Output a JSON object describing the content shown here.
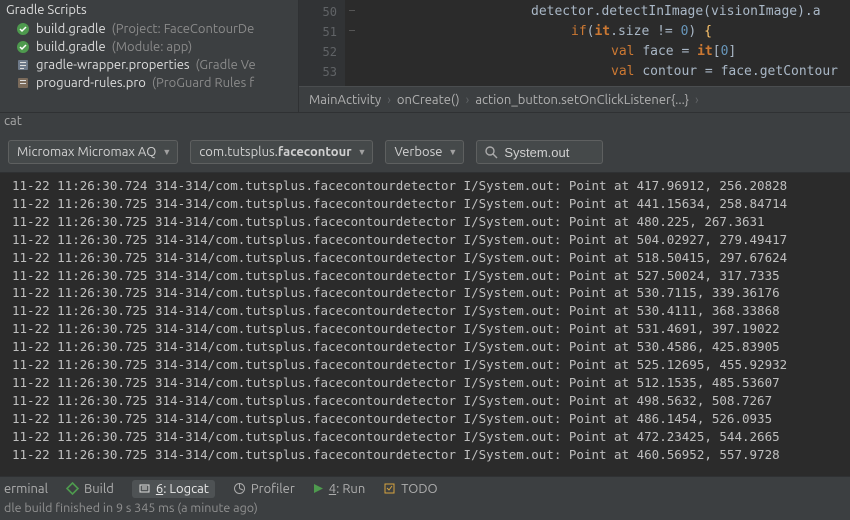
{
  "tree": {
    "header": "Gradle Scripts",
    "items": [
      {
        "name": "build.gradle",
        "sub": " (Project: FaceContourDe",
        "icon": "gradle"
      },
      {
        "name": "build.gradle",
        "sub": " (Module: app)",
        "icon": "gradle"
      },
      {
        "name": "gradle-wrapper.properties",
        "sub": " (Gradle Ve",
        "icon": "props"
      },
      {
        "name": "proguard-rules.pro",
        "sub": " (ProGuard Rules f",
        "icon": "pro"
      }
    ]
  },
  "editor": {
    "gutter": [
      "50",
      "51",
      "52",
      "53"
    ],
    "lines": [
      {
        "indent": 170,
        "tokens": [
          [
            "c-base",
            "detector.detectInImage(visionImage).a"
          ]
        ]
      },
      {
        "indent": 210,
        "tokens": [
          [
            "c-key",
            "if"
          ],
          [
            "c-base",
            "("
          ],
          [
            "c-key c-bold",
            "it"
          ],
          [
            "c-base",
            ".size != "
          ],
          [
            "c-num",
            "0"
          ],
          [
            "c-base",
            ") "
          ],
          [
            "c-kw2",
            "{"
          ]
        ]
      },
      {
        "indent": 250,
        "tokens": [
          [
            "c-key",
            "val "
          ],
          [
            "c-base",
            "face = "
          ],
          [
            "c-key c-bold",
            "it"
          ],
          [
            "c-base",
            "["
          ],
          [
            "c-num",
            "0"
          ],
          [
            "c-base",
            "]"
          ]
        ]
      },
      {
        "indent": 250,
        "tokens": [
          [
            "c-key",
            "val "
          ],
          [
            "c-id",
            "contour = face.getContour"
          ]
        ]
      }
    ],
    "breadcrumbs": [
      "MainActivity",
      "onCreate()",
      "action_button.setOnClickListener{...}"
    ]
  },
  "panel_tab": "cat",
  "toolbar": {
    "device": "Micromax Micromax AQ",
    "package_html": "com.tutsplus.<b>facecontour</b>",
    "package": "com.tutsplus.facecontour",
    "level": "Verbose",
    "search_value": "System.out"
  },
  "log_prefix": "11-22 11:26:30.",
  "log_ms": [
    "724",
    "725",
    "725",
    "725",
    "725",
    "725",
    "725",
    "725",
    "725",
    "725",
    "725",
    "725",
    "725",
    "725",
    "725",
    "725"
  ],
  "log_proc": "314-314/com.tutsplus.facecontourdetector I/System.out: Point at ",
  "log_points": [
    "417.96912, 256.20828",
    "441.15634, 258.84714",
    "480.225, 267.3631",
    "504.02927, 279.49417",
    "518.50415, 297.67624",
    "527.50024, 317.7335",
    "530.7115, 339.36176",
    "530.4111, 368.33868",
    "531.4691, 397.19022",
    "530.4586, 425.83905",
    "525.12695, 455.92932",
    "512.1535, 485.53607",
    "498.5632, 508.7267",
    "486.1454, 526.0935",
    "472.23425, 544.2665",
    "460.56952, 557.9728"
  ],
  "bottom_tabs": {
    "terminal": "erminal",
    "build": "Build",
    "logcat": "6: Logcat",
    "profiler": "Profiler",
    "run": "4: Run",
    "todo": "TODO"
  },
  "status": "dle build finished in 9 s 345 ms (a minute ago)"
}
